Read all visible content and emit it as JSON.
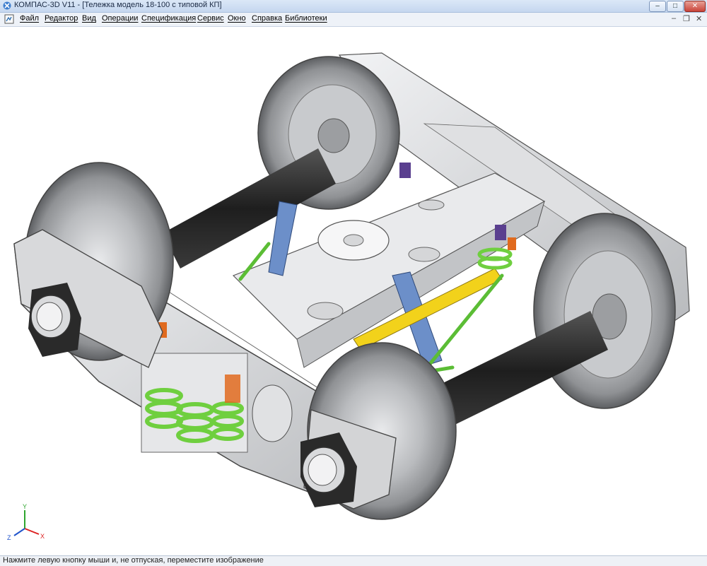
{
  "window": {
    "title": "КОМПАС-3D V11 - [Тележка модель 18-100 с типовой КП]",
    "controls": {
      "minimize": "–",
      "maximize": "□",
      "close": "✕"
    }
  },
  "menu": {
    "items": [
      "Файл",
      "Редактор",
      "Вид",
      "Операции",
      "Спецификация",
      "Сервис",
      "Окно",
      "Справка",
      "Библиотеки"
    ],
    "mdi_controls": {
      "minimize": "–",
      "restore": "❐",
      "close": "✕"
    }
  },
  "viewport": {
    "axis": {
      "x": "X",
      "y": "Y",
      "z": "Z"
    }
  },
  "status": {
    "text": "Нажмите левую кнопку мыши и, не отпуская, переместите изображение"
  },
  "colors": {
    "frame": "#cfd1d4",
    "wheel": "#9c9ea1",
    "axle": "#2b2b2b",
    "spring": "#6fcf3f",
    "brace_yellow": "#f2d21b",
    "link_blue": "#6c8fc9",
    "accent_orange": "#e06a1e",
    "accent_purple": "#5a3f8f"
  }
}
